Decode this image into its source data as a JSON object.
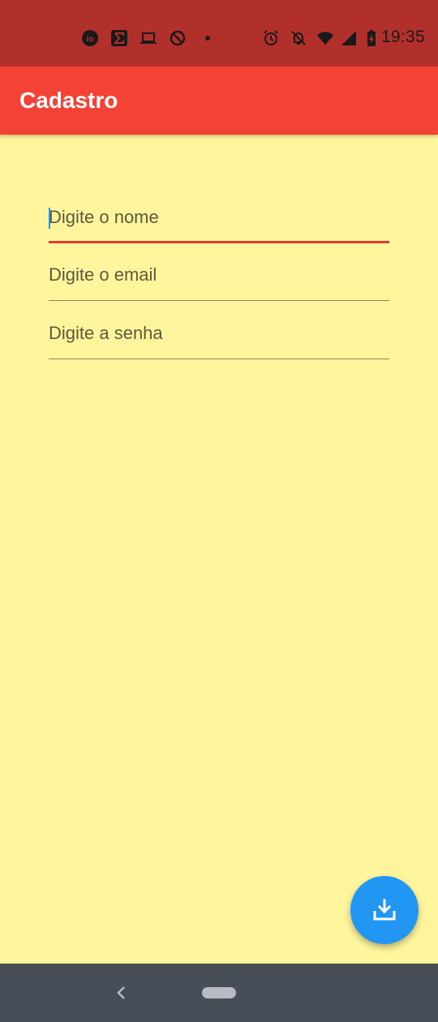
{
  "status_bar": {
    "time": "19:35",
    "icons": [
      "io-app-icon",
      "sigma-app-icon",
      "laptop-icon",
      "sync-disabled-icon",
      "dot-icon",
      "alarm-icon",
      "notifications-off-icon",
      "wifi-icon",
      "cellular-signal-icon",
      "battery-charging-icon"
    ],
    "background": "#B2302B"
  },
  "app_bar": {
    "title": "Cadastro",
    "background": "#F44336"
  },
  "form": {
    "name_placeholder": "Digite o nome",
    "email_placeholder": "Digite o email",
    "password_placeholder": "Digite a senha",
    "focused_field": "name",
    "background": "#FFF59D",
    "focus_color": "#E53935"
  },
  "fab": {
    "icon": "download-icon",
    "color": "#2196F3"
  },
  "nav_bar": {
    "background": "#474E57",
    "icons": [
      "back-icon",
      "home-pill"
    ]
  }
}
